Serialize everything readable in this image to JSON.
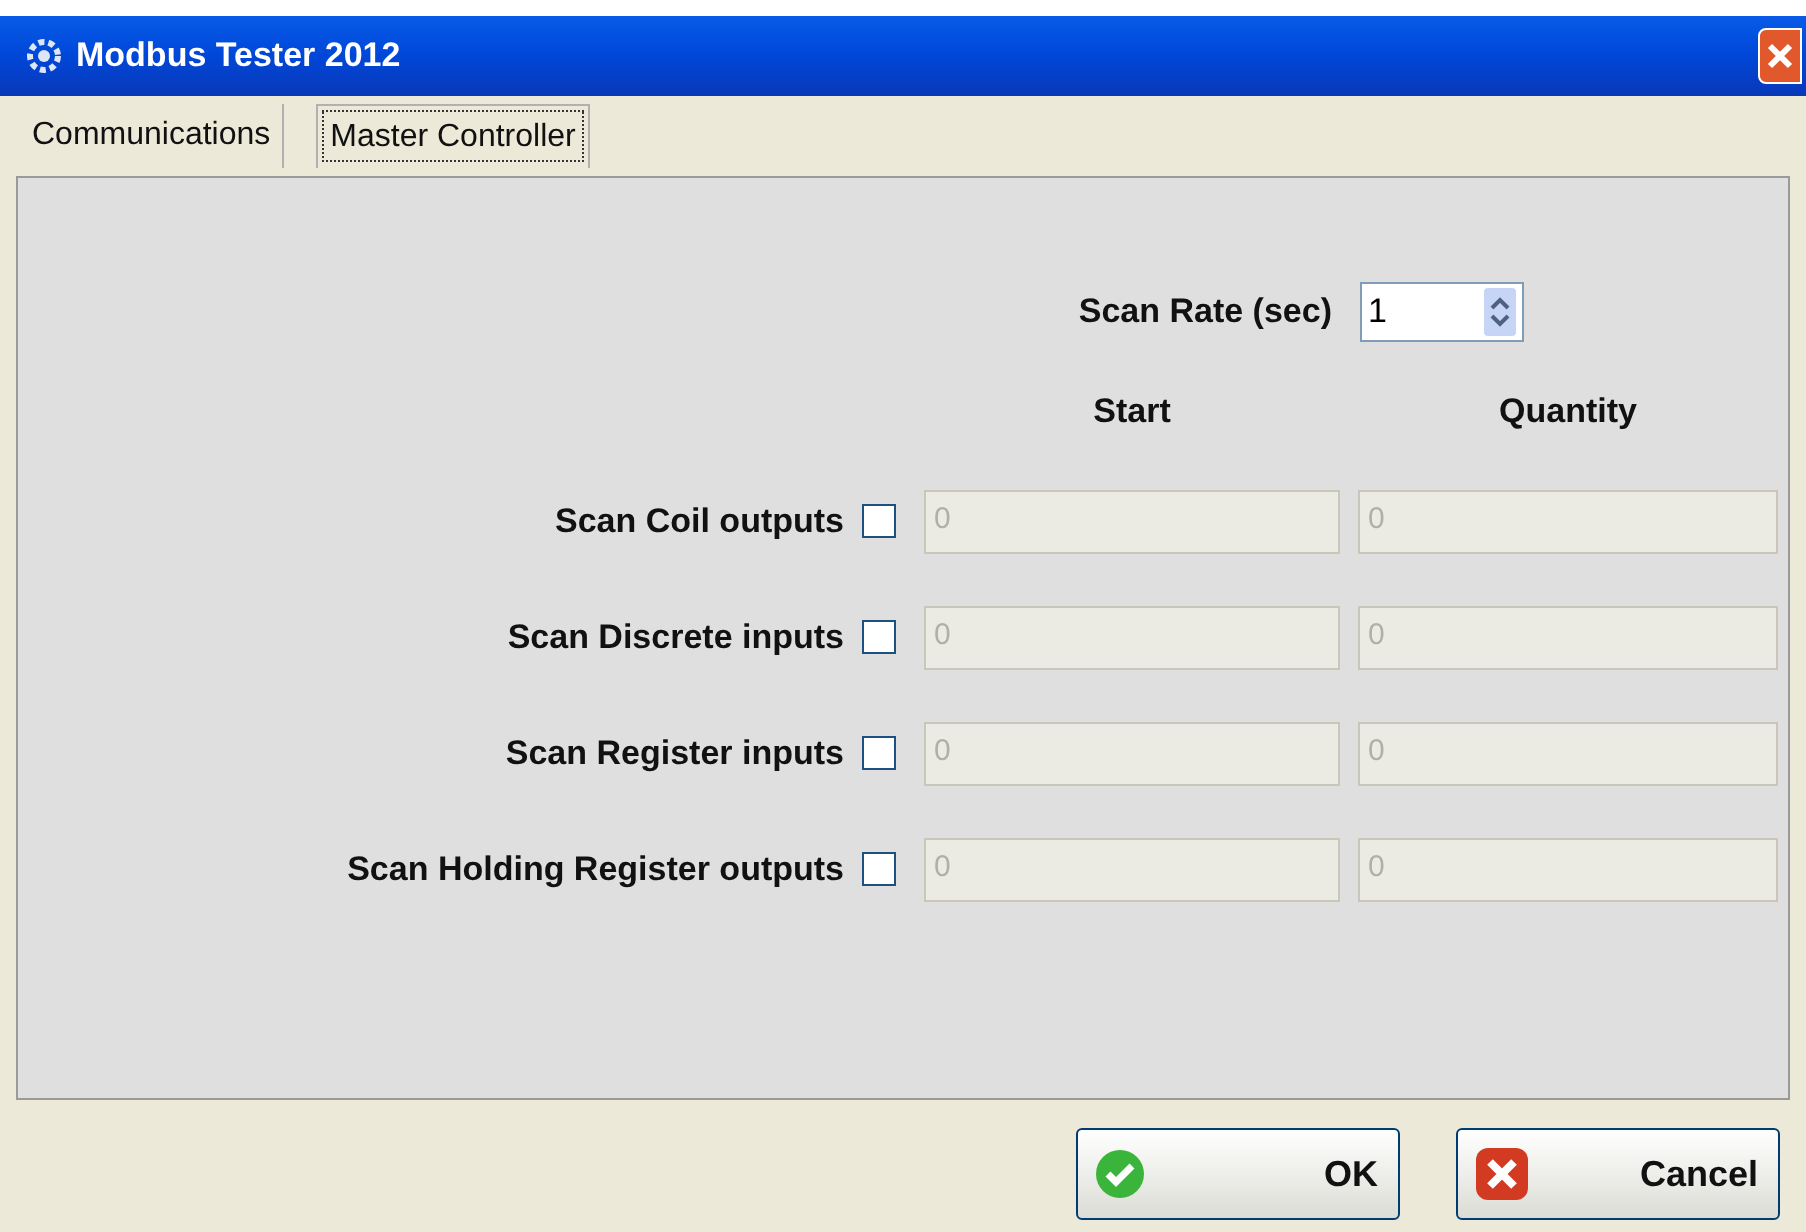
{
  "window": {
    "title": "Modbus Tester 2012"
  },
  "tabs": [
    {
      "label": "Communications",
      "selected": false
    },
    {
      "label": "Master Controller",
      "selected": true
    }
  ],
  "scan_rate": {
    "label": "Scan Rate (sec)",
    "value": "1"
  },
  "columns": [
    "Start",
    "Quantity"
  ],
  "rows": [
    {
      "label": "Scan Coil outputs",
      "checked": false,
      "start": "0",
      "quantity": "0",
      "disabled": true
    },
    {
      "label": "Scan Discrete inputs",
      "checked": false,
      "start": "0",
      "quantity": "0",
      "disabled": true
    },
    {
      "label": "Scan Register inputs",
      "checked": false,
      "start": "0",
      "quantity": "0",
      "disabled": true
    },
    {
      "label": "Scan Holding Register outputs",
      "checked": false,
      "start": "0",
      "quantity": "0",
      "disabled": true
    }
  ],
  "buttons": [
    {
      "label": "OK",
      "kind": "ok"
    },
    {
      "label": "Cancel",
      "kind": "cancel"
    }
  ]
}
